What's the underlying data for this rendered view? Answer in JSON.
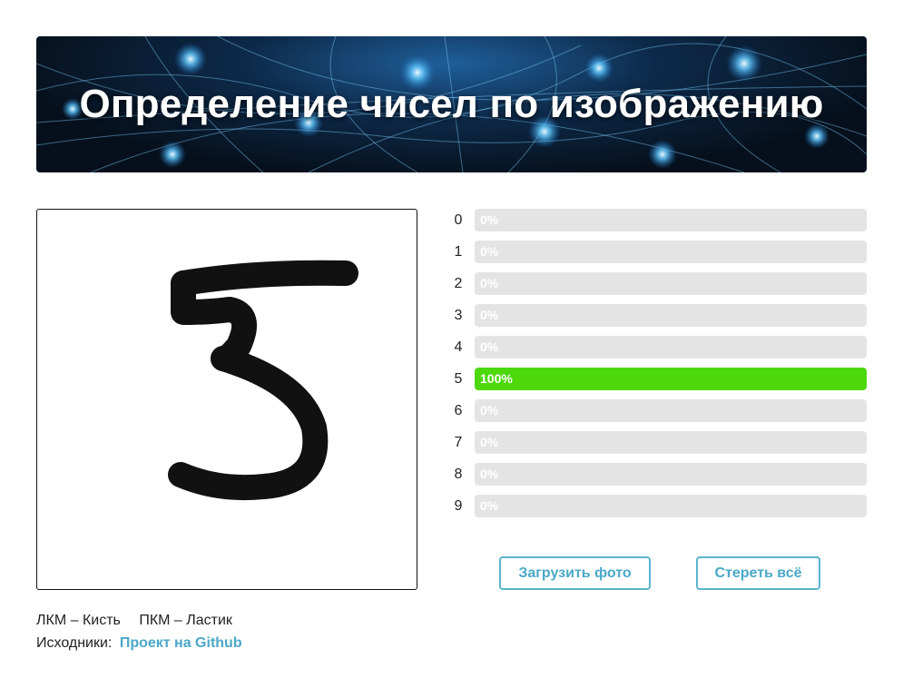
{
  "header": {
    "title": "Определение чисел по изображению"
  },
  "canvas": {
    "drawn_digit_icon": "handwritten-five"
  },
  "predictions": [
    {
      "digit": "0",
      "label": "0%",
      "value": 0
    },
    {
      "digit": "1",
      "label": "0%",
      "value": 0
    },
    {
      "digit": "2",
      "label": "0%",
      "value": 0
    },
    {
      "digit": "3",
      "label": "0%",
      "value": 0
    },
    {
      "digit": "4",
      "label": "0%",
      "value": 0
    },
    {
      "digit": "5",
      "label": "100%",
      "value": 100
    },
    {
      "digit": "6",
      "label": "0%",
      "value": 0
    },
    {
      "digit": "7",
      "label": "0%",
      "value": 0
    },
    {
      "digit": "8",
      "label": "0%",
      "value": 0
    },
    {
      "digit": "9",
      "label": "0%",
      "value": 0
    }
  ],
  "buttons": {
    "upload_label": "Загрузить фото",
    "clear_label": "Стереть всё"
  },
  "hints": {
    "left_click": "ЛКМ – Кисть",
    "right_click": "ПКМ – Ластик"
  },
  "footer": {
    "source_label": "Исходники:",
    "source_link": "Проект на Github"
  },
  "colors": {
    "bar_active": "#4cd80a",
    "bar_track": "#e4e4e4",
    "accent": "#4aa8c8"
  }
}
